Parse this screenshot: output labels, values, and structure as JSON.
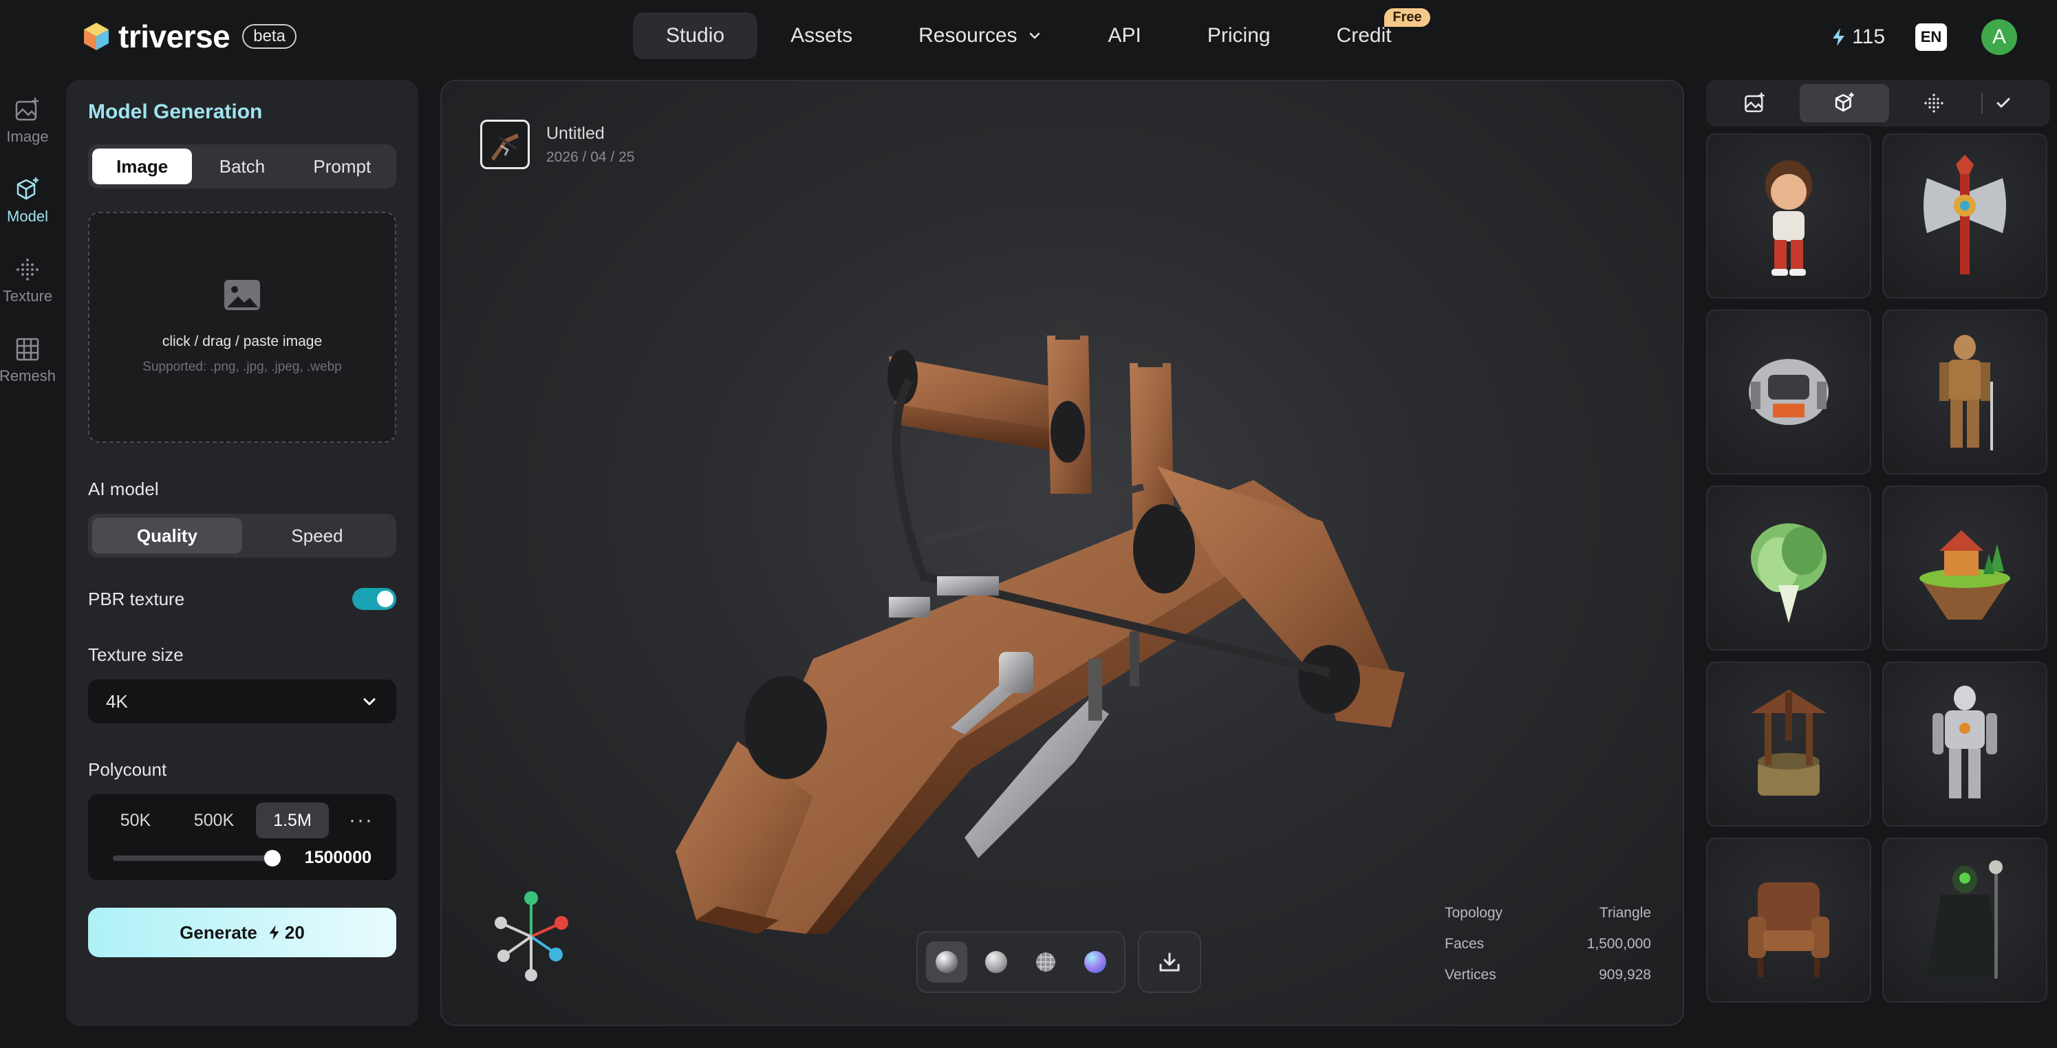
{
  "brand": {
    "name": "triverse",
    "badge": "beta"
  },
  "nav": {
    "items": [
      {
        "label": "Studio",
        "active": true
      },
      {
        "label": "Assets"
      },
      {
        "label": "Resources",
        "has_dropdown": true
      },
      {
        "label": "API"
      },
      {
        "label": "Pricing"
      },
      {
        "label": "Credit",
        "tag": "Free"
      }
    ]
  },
  "account": {
    "credits": "115",
    "language": "EN",
    "avatar_initial": "A"
  },
  "rail": [
    {
      "label": "Image",
      "icon": "image-plus-icon"
    },
    {
      "label": "Model",
      "icon": "cube-sparkle-icon",
      "active": true
    },
    {
      "label": "Texture",
      "icon": "texture-dots-icon"
    },
    {
      "label": "Remesh",
      "icon": "grid-icon"
    }
  ],
  "panel": {
    "title": "Model Generation",
    "input_tabs": [
      "Image",
      "Batch",
      "Prompt"
    ],
    "active_input_tab": "Image",
    "dropzone": {
      "main": "click / drag / paste image",
      "sub": "Supported: .png, .jpg, .jpeg, .webp"
    },
    "ai_model": {
      "label": "AI model",
      "options": [
        "Quality",
        "Speed"
      ],
      "selected": "Quality"
    },
    "pbr": {
      "label": "PBR texture",
      "enabled": true
    },
    "texture_size": {
      "label": "Texture size",
      "value": "4K"
    },
    "polycount": {
      "label": "Polycount",
      "options": [
        "50K",
        "500K",
        "1.5M"
      ],
      "selected": "1.5M",
      "more": "···",
      "value": "1500000",
      "slider_fraction": 1.0
    },
    "generate": {
      "label": "Generate",
      "cost": "20"
    }
  },
  "viewer": {
    "asset_name": "Untitled",
    "asset_date": "2026 / 04 / 25",
    "stats": [
      {
        "label": "Topology",
        "value": "Triangle"
      },
      {
        "label": "Faces",
        "value": "1,500,000"
      },
      {
        "label": "Vertices",
        "value": "909,928"
      }
    ],
    "shading_modes": [
      "shaded-icon",
      "clay-icon",
      "wireframe-icon",
      "normal-icon"
    ],
    "active_shading": "shaded-icon",
    "download_icon": "download-icon"
  },
  "gallery": {
    "tabs": [
      "image-icon",
      "model-icon",
      "texture-icon"
    ],
    "active_tab": "model-icon",
    "items": [
      "cartoon-boy",
      "ornate-axe",
      "robot-pod",
      "armored-knight",
      "cabbage",
      "floating-island-house",
      "wishing-well",
      "silver-robot",
      "leather-armchair",
      "dark-mage"
    ]
  },
  "colors": {
    "accent": "#9fe3f0",
    "toggle": "#1aa3b4",
    "avatar": "#3fa84b",
    "free_tag": "#f6c88a"
  }
}
